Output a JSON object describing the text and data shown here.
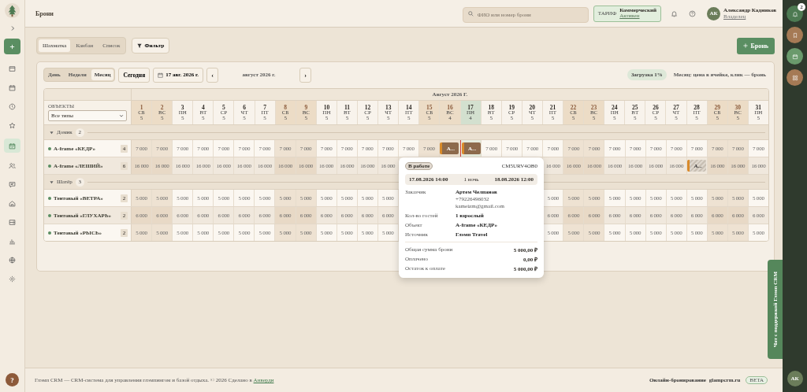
{
  "sidebar": {
    "nav": [
      {
        "selected": false
      },
      {
        "selected": false
      },
      {
        "selected": false
      },
      {
        "selected": false
      },
      {
        "selected": true
      },
      {
        "selected": false
      },
      {
        "selected": false
      },
      {
        "selected": false
      },
      {
        "selected": false
      },
      {
        "selected": false
      },
      {
        "selected": false
      },
      {
        "selected": false
      }
    ],
    "help": "?"
  },
  "header": {
    "title": "Брони",
    "search": {
      "placeholder": "ФИО или номер брони"
    },
    "tariff": {
      "label": "ТАРИФ",
      "plan": "Коммерческий",
      "status": "Активен"
    },
    "user": {
      "initials": "АК",
      "name": "Александр Кадников",
      "role": "Владелец"
    }
  },
  "view_tabs": [
    {
      "label": "Шахматка",
      "selected": true
    },
    {
      "label": "Канбан",
      "selected": false
    },
    {
      "label": "Список",
      "selected": false
    }
  ],
  "filter_button": "Фильтр",
  "add_button": "Бронь",
  "period_tabs": [
    {
      "label": "День",
      "selected": false
    },
    {
      "label": "Недели",
      "selected": false
    },
    {
      "label": "Месяц",
      "selected": true
    }
  ],
  "today_button": "Сегодня",
  "date_picker": "17 авг. 2026 г.",
  "period_label": "август 2026 г.",
  "prev_button": "‹",
  "next_button": "›",
  "load_badge": "Загрузка 1%",
  "hint": "Месяц: цена в ячейке, клик — бронь",
  "grid": {
    "month": "Август 2026 Г.",
    "objects_header": "ОБЪЕКТЫ",
    "type_filter": "Все типы",
    "days": [
      {
        "day": "1",
        "weekday": "СБ",
        "free": "5",
        "weekend": true,
        "today": false
      },
      {
        "day": "2",
        "weekday": "ВС",
        "free": "5",
        "weekend": true,
        "today": false
      },
      {
        "day": "3",
        "weekday": "ПН",
        "free": "5",
        "weekend": false,
        "today": false
      },
      {
        "day": "4",
        "weekday": "ВТ",
        "free": "5",
        "weekend": false,
        "today": false
      },
      {
        "day": "5",
        "weekday": "СР",
        "free": "5",
        "weekend": false,
        "today": false
      },
      {
        "day": "6",
        "weekday": "ЧТ",
        "free": "5",
        "weekend": false,
        "today": false
      },
      {
        "day": "7",
        "weekday": "ПТ",
        "free": "5",
        "weekend": false,
        "today": false
      },
      {
        "day": "8",
        "weekday": "СБ",
        "free": "5",
        "weekend": true,
        "today": false
      },
      {
        "day": "9",
        "weekday": "ВС",
        "free": "5",
        "weekend": true,
        "today": false
      },
      {
        "day": "10",
        "weekday": "ПН",
        "free": "5",
        "weekend": false,
        "today": false
      },
      {
        "day": "11",
        "weekday": "ВТ",
        "free": "5",
        "weekend": false,
        "today": false
      },
      {
        "day": "12",
        "weekday": "СР",
        "free": "5",
        "weekend": false,
        "today": false
      },
      {
        "day": "13",
        "weekday": "ЧТ",
        "free": "5",
        "weekend": false,
        "today": false
      },
      {
        "day": "14",
        "weekday": "ПТ",
        "free": "5",
        "weekend": false,
        "today": false
      },
      {
        "day": "15",
        "weekday": "СБ",
        "free": "5",
        "weekend": true,
        "today": false
      },
      {
        "day": "16",
        "weekday": "ВС",
        "free": "4",
        "weekend": true,
        "today": false
      },
      {
        "day": "17",
        "weekday": "ПН",
        "free": "4",
        "weekend": false,
        "today": true
      },
      {
        "day": "18",
        "weekday": "ВТ",
        "free": "5",
        "weekend": false,
        "today": false
      },
      {
        "day": "19",
        "weekday": "СР",
        "free": "5",
        "weekend": false,
        "today": false
      },
      {
        "day": "20",
        "weekday": "ЧТ",
        "free": "5",
        "weekend": false,
        "today": false
      },
      {
        "day": "21",
        "weekday": "ПТ",
        "free": "5",
        "weekend": false,
        "today": false
      },
      {
        "day": "22",
        "weekday": "СБ",
        "free": "5",
        "weekend": true,
        "today": false
      },
      {
        "day": "23",
        "weekday": "ВС",
        "free": "5",
        "weekend": true,
        "today": false
      },
      {
        "day": "24",
        "weekday": "ПН",
        "free": "5",
        "weekend": false,
        "today": false
      },
      {
        "day": "25",
        "weekday": "ВТ",
        "free": "5",
        "weekend": false,
        "today": false
      },
      {
        "day": "26",
        "weekday": "СР",
        "free": "5",
        "weekend": false,
        "today": false
      },
      {
        "day": "27",
        "weekday": "ЧТ",
        "free": "5",
        "weekend": false,
        "today": false
      },
      {
        "day": "28",
        "weekday": "ПТ",
        "free": "5",
        "weekend": false,
        "today": false
      },
      {
        "day": "29",
        "weekday": "СБ",
        "free": "5",
        "weekend": true,
        "today": false
      },
      {
        "day": "30",
        "weekday": "ВС",
        "free": "5",
        "weekend": true,
        "today": false
      },
      {
        "day": "31",
        "weekday": "ПН",
        "free": "5",
        "weekend": false,
        "today": false
      }
    ],
    "groups": [
      {
        "name": "Домик",
        "count": "2",
        "expanded": true,
        "objects": [
          {
            "name": "A-frame «КЕДР»",
            "units": "4",
            "cells": [
              "7 000",
              "7 000",
              "7 000",
              "7 000",
              "7 000",
              "7 000",
              "7 000",
              "7 000",
              "7 000",
              "7 000",
              "7 000",
              "7 000",
              "7 000",
              "7 000",
              "7 000",
              {
                "kind": "booking",
                "label": "А...",
                "tentative": false
              },
              {
                "kind": "booking",
                "label": "А...",
                "tentative": false
              },
              "7 000",
              "7 000",
              "7 000",
              "7 000",
              "7 000",
              "7 000",
              "7 000",
              "7 000",
              "7 000",
              "7 000",
              "7 000",
              "7 000",
              "7 000",
              "7 000"
            ]
          },
          {
            "name": "A-frame «ЛЕШИЙ»",
            "units": "6",
            "cells": [
              "16 000",
              "16 000",
              "16 000",
              "16 000",
              "16 000",
              "16 000",
              "16 000",
              "16 000",
              "16 000",
              "16 000",
              "16 000",
              "16 000",
              "16 000",
              null,
              null,
              null,
              null,
              null,
              null,
              null,
              "16 000",
              "16 000",
              "16 000",
              "16 000",
              "16 000",
              "16 000",
              "16 000",
              {
                "kind": "booking",
                "label": "А...",
                "tentative": true
              },
              "16 000",
              "16 000",
              "16 000"
            ]
          }
        ]
      },
      {
        "name": "Шатёр",
        "count": "3",
        "expanded": true,
        "objects": [
          {
            "name": "Тентовый «ВЕТРА»",
            "units": "2",
            "cells": [
              "5 000",
              "5 000",
              "5 000",
              "5 000",
              "5 000",
              "5 000",
              "5 000",
              "5 000",
              "5 000",
              "5 000",
              "5 000",
              "5 000",
              "5 000",
              null,
              null,
              null,
              null,
              null,
              null,
              null,
              "5 000",
              "5 000",
              "5 000",
              "5 000",
              "5 000",
              "5 000",
              "5 000",
              "5 000",
              "5 000",
              "5 000",
              "5 000"
            ]
          },
          {
            "name": "Тентовый «ГЛУХАРЬ»",
            "units": "2",
            "cells": [
              "6 000",
              "6 000",
              "6 000",
              "6 000",
              "6 000",
              "6 000",
              "6 000",
              "6 000",
              "6 000",
              "6 000",
              "6 000",
              "6 000",
              "6 000",
              null,
              null,
              null,
              null,
              null,
              null,
              null,
              "6 000",
              "6 000",
              "6 000",
              "6 000",
              "6 000",
              "6 000",
              "6 000",
              "6 000",
              "6 000",
              "6 000",
              "6 000"
            ]
          },
          {
            "name": "Тентовый «РЫСЬ»",
            "units": "2",
            "cells": [
              "5 000",
              "5 000",
              "5 000",
              "5 000",
              "5 000",
              "5 000",
              "5 000",
              "5 000",
              "5 000",
              "5 000",
              "5 000",
              "5 000",
              "5 000",
              null,
              null,
              null,
              null,
              null,
              null,
              null,
              "5 000",
              "5 000",
              "5 000",
              "5 000",
              "5 000",
              "5 000",
              "5 000",
              "5 000",
              "5 000",
              "5 000",
              "5 000"
            ]
          }
        ]
      }
    ]
  },
  "popover": {
    "status": "В работе",
    "code": "CM5URV4OB0",
    "check_in": "17.08.2026 14:00",
    "nights": "1 ночь",
    "check_out": "18.08.2026 12:00",
    "fields": [
      {
        "label": "Заказчик",
        "values": [
          "Артем Челпанов",
          "+79226496032",
          "kameizm@gmail.com"
        ]
      },
      {
        "label": "Кол-во гостей",
        "values": [
          "1 взрослый"
        ]
      },
      {
        "label": "Объект",
        "values": [
          "A-frame «КЕДР»"
        ]
      },
      {
        "label": "Источник",
        "values": [
          "Глэмп Travel"
        ]
      }
    ],
    "totals": [
      {
        "label": "Общая сумма брони",
        "value": "5 000,00 ₽"
      },
      {
        "label": "Оплачено",
        "value": "0,00 ₽"
      },
      {
        "label": "Остаток к оплате",
        "value": "5 000,00 ₽"
      }
    ]
  },
  "support_tab": "Чат с поддержкой Глэмп CRM",
  "footer": {
    "text": "Глэмп CRM — CRM-система для управления глэмпингом и базой отдыха. © 2026 Сделано в ",
    "link": "Анверди",
    "booking_label": "Онлайн-бронирование",
    "site": "glampcrm.ru",
    "badge": "BETA"
  },
  "rail": {
    "badge": "2",
    "initials": "АК"
  }
}
